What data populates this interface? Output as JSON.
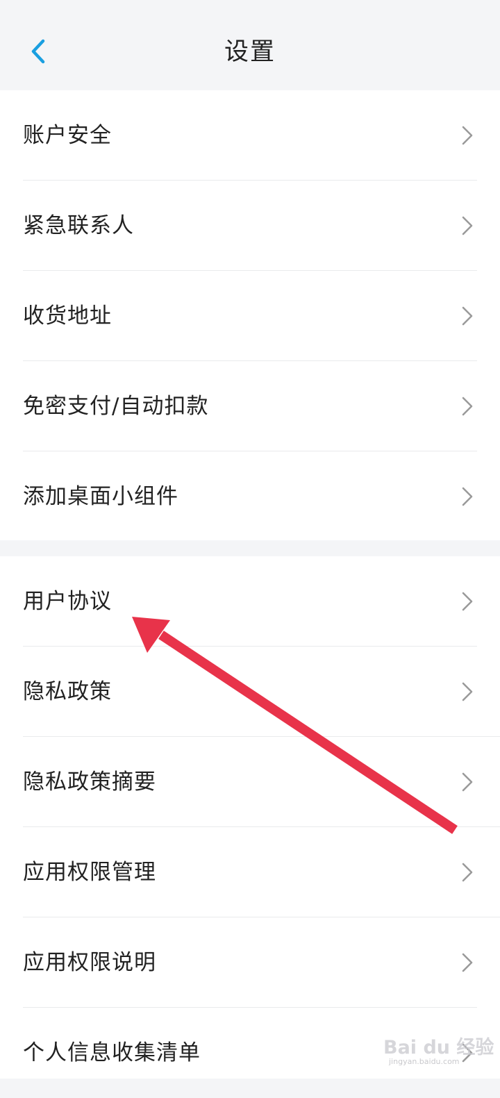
{
  "header": {
    "title": "设置",
    "back_icon": "chevron-left-icon",
    "accent_color": "#1a9fe0"
  },
  "groups": [
    {
      "items": [
        {
          "label": "账户安全",
          "icon": "chevron-right-icon"
        },
        {
          "label": "紧急联系人",
          "icon": "chevron-right-icon"
        },
        {
          "label": "收货地址",
          "icon": "chevron-right-icon"
        },
        {
          "label": "免密支付/自动扣款",
          "icon": "chevron-right-icon"
        },
        {
          "label": "添加桌面小组件",
          "icon": "chevron-right-icon"
        }
      ]
    },
    {
      "items": [
        {
          "label": "用户协议",
          "icon": "chevron-right-icon"
        },
        {
          "label": "隐私政策",
          "icon": "chevron-right-icon"
        },
        {
          "label": "隐私政策摘要",
          "icon": "chevron-right-icon"
        },
        {
          "label": "应用权限管理",
          "icon": "chevron-right-icon"
        },
        {
          "label": "应用权限说明",
          "icon": "chevron-right-icon"
        },
        {
          "label": "个人信息收集清单",
          "icon": "chevron-right-icon"
        }
      ]
    }
  ],
  "annotation": {
    "arrow_color": "#e8334a",
    "points_to": "用户协议"
  },
  "watermark": {
    "logo_text": "Bai du 经验",
    "url": "jingyan.baidu.com"
  }
}
